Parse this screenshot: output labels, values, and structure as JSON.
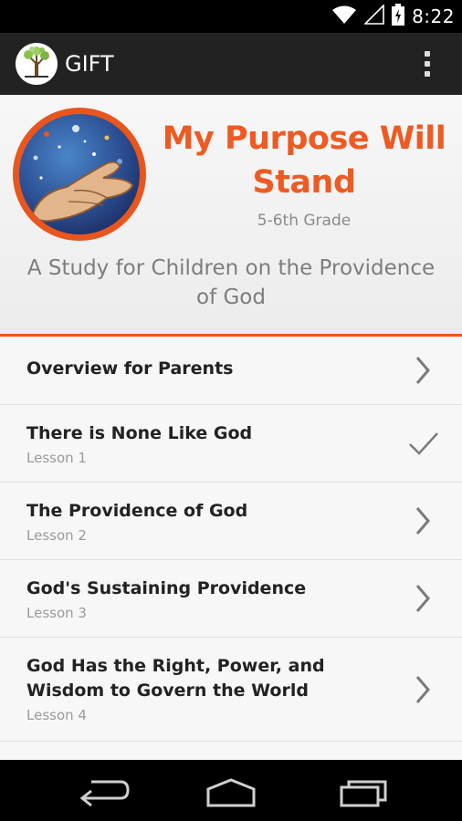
{
  "status_bar": {
    "time": "8:22"
  },
  "app_bar": {
    "title": "GIFT"
  },
  "header": {
    "title": "My Purpose Will Stand",
    "grade": "5-6th Grade",
    "subtitle": "A Study for Children on the Providence of God"
  },
  "lessons": [
    {
      "title": "Overview for Parents",
      "subtitle": "",
      "status": "chevron-right-icon"
    },
    {
      "title": "There is None Like God",
      "subtitle": "Lesson 1",
      "status": "checkmark-icon"
    },
    {
      "title": "The Providence of God",
      "subtitle": "Lesson 2",
      "status": "chevron-right-icon"
    },
    {
      "title": "God's Sustaining Providence",
      "subtitle": "Lesson 3",
      "status": "chevron-right-icon"
    },
    {
      "title": "God Has the Right, Power, and Wisdom to Govern the World",
      "subtitle": "Lesson 4",
      "status": "chevron-right-icon"
    }
  ],
  "colors": {
    "accent": "#ee5a22",
    "action_bar": "#222222",
    "status_bar": "#000000"
  }
}
